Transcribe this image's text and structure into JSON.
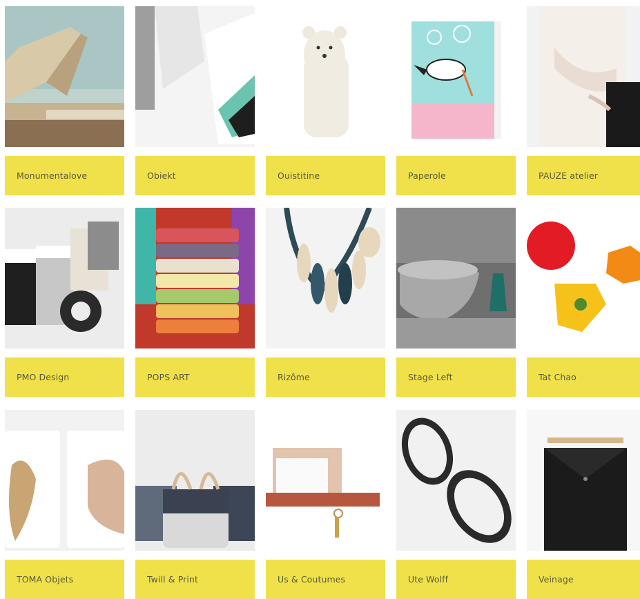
{
  "colors": {
    "accent": "#f0e04a",
    "text": "#5a5a3a"
  },
  "items": [
    {
      "label": "Monumentalove"
    },
    {
      "label": "Obiekt"
    },
    {
      "label": "Ouistitine"
    },
    {
      "label": "Paperole"
    },
    {
      "label": "PAUZE atelier"
    },
    {
      "label": "PMO Design"
    },
    {
      "label": "POPS ART"
    },
    {
      "label": "Rizôme"
    },
    {
      "label": "Stage Left"
    },
    {
      "label": "Tat Chao"
    },
    {
      "label": "TOMA Objets"
    },
    {
      "label": "Twill & Print"
    },
    {
      "label": "Us & Coutumes"
    },
    {
      "label": "Ute Wolff"
    },
    {
      "label": "Veinage"
    }
  ]
}
